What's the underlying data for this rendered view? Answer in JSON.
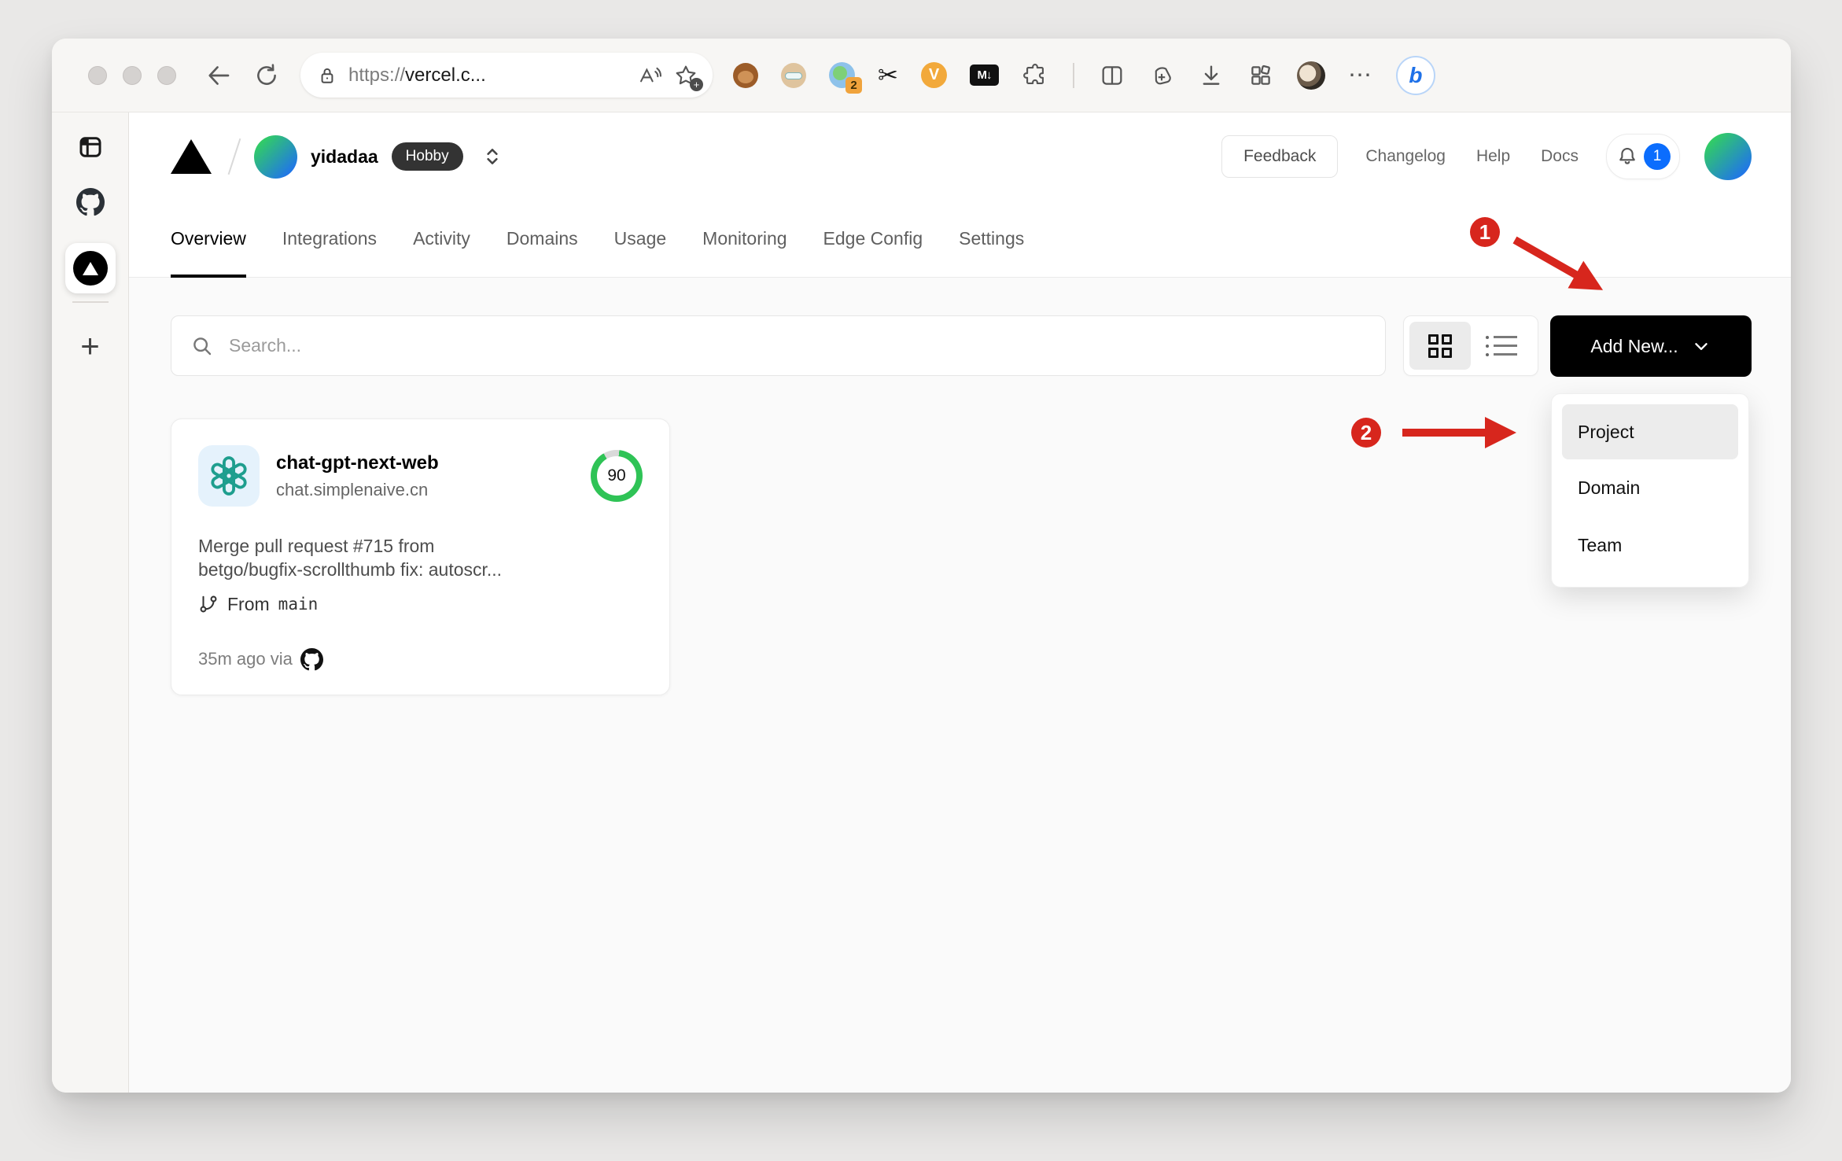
{
  "browser": {
    "url": {
      "scheme": "https://",
      "host": "vercel.c..."
    },
    "extension_badge": "2",
    "markdown_ext_label": "M↓",
    "v_ext_label": "V",
    "more_label": "⋯",
    "bing_label": "b",
    "scissors_glyph": "✂",
    "plus_tab_label": "+"
  },
  "vercel": {
    "team_name": "yidadaa",
    "plan_badge": "Hobby",
    "feedback_label": "Feedback",
    "links": [
      "Changelog",
      "Help",
      "Docs"
    ],
    "notification_count": "1",
    "tabs": [
      "Overview",
      "Integrations",
      "Activity",
      "Domains",
      "Usage",
      "Monitoring",
      "Edge Config",
      "Settings"
    ],
    "search_placeholder": "Search...",
    "add_new_label": "Add New...",
    "dropdown_items": [
      "Project",
      "Domain",
      "Team"
    ],
    "dropdown_selected": "Project",
    "card": {
      "name": "chat-gpt-next-web",
      "domain": "chat.simplenaive.cn",
      "score": "90",
      "commit_line1": "Merge pull request #715 from",
      "commit_line2": "betgo/bugfix-scrollthumb fix: autoscr...",
      "branch_prefix": "From",
      "branch_name": "main",
      "time_text": "35m ago via"
    }
  },
  "annotations": {
    "step1": "1",
    "step2": "2"
  },
  "icons": [
    "lock-icon",
    "read-aloud-icon",
    "favorites-add-icon",
    "tampermonkey-icon",
    "persona-icon",
    "proxy-icon",
    "scissors-icon",
    "v-ext-icon",
    "markdown-icon",
    "puzzle-icon",
    "split-screen-icon",
    "collections-icon",
    "download-icon",
    "apps-icon",
    "profile-avatar",
    "bing-chat-icon",
    "sidebar-toggle-icon",
    "github-icon",
    "vercel-favicon",
    "new-tab-icon",
    "vercel-logo",
    "search-icon",
    "grid-view-icon",
    "list-view-icon",
    "chevron-down-icon",
    "bell-icon",
    "openai-logo",
    "git-branch-icon"
  ],
  "colors": {
    "annotation_red": "#d7261d",
    "score_green": "#2fc356",
    "notification_blue": "#0b6dfd",
    "avatar_gradient_green": "#33d35b",
    "avatar_gradient_blue": "#1f6ff2",
    "button_black": "#000000",
    "page_body_gray": "#fafafa"
  }
}
